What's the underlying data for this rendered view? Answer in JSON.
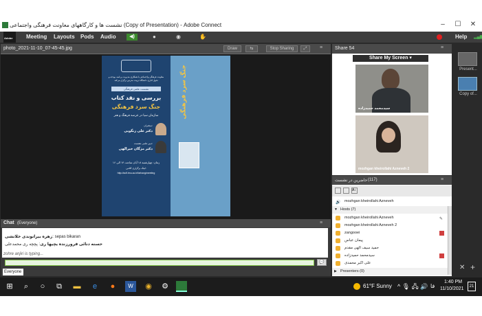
{
  "window": {
    "title": "نشست ها و کارگاههای معاونت فرهنگی واجتماعی (Copy of Presentation) - Adobe Connect",
    "minimize": "–",
    "maximize": "☐",
    "close": "✕"
  },
  "menubar": {
    "logo": "Adobe",
    "items": [
      "Meeting",
      "Layouts",
      "Pods",
      "Audio"
    ],
    "help": "Help"
  },
  "share_pod": {
    "title": "photo_2021-11-10_07-45-45.jpg",
    "draw_label": "Draw",
    "stop_label": "Stop Sharing"
  },
  "poster": {
    "header_lines": [
      "معاونت فرهنگی واجتماعی با همکاری مدیریت برنامه، بودجه و",
      "تحول اداری دانشگاه تربیت مدرس برگزار می‌کند"
    ],
    "banner": "نشست علمی فرهنگی",
    "title1": "بررسی و نقد کتاب",
    "title2": "جنگ سرد فرهنگی",
    "title3": "سازمان سیا در عرصه فرهنگ و هنر",
    "speaker_label": "سخنران:",
    "speaker_name": "دکتر علی زنگویی",
    "moderator_label": "دبیر علمی نشست:",
    "moderator_name": "دکتر مژگان خیرالهی",
    "when": "زمان: چهارشنبه ۱۸ آبان ساعت ۱۴ الی ۱۶",
    "link_label": "لینک برگزاری کلاس:",
    "url": "http://acfl.tmu.ac.ir/farhangimeeting",
    "book_cover_title": "جنگ سرد فرهنگی"
  },
  "chat": {
    "title": "Chat",
    "scope": "(Everyone)",
    "messages": [
      {
        "sender": "زهره بیرانوندی خلانشی",
        "text": "sepas bikaran"
      },
      {
        "sender": "حسنه دنائی فرورزنده یچیها ری",
        "text": "پچچه ری محمدعلی"
      }
    ],
    "typing": "zohre anjiri is typing...",
    "tab": "Everyone"
  },
  "camera_pod": {
    "title": "Share 54",
    "share_my_screen": "Share My Screen",
    "videos": [
      {
        "label": "سیدمحمد حمیدزاده"
      },
      {
        "label": "mozhgan kheirollahi Azneveh 2"
      }
    ]
  },
  "attendee_pod": {
    "title": "حاضرین در نشست",
    "count": "(117)",
    "speaker": "mozhgan kheirollahi Azneveh",
    "hosts_label": "Hosts (7)",
    "hosts": [
      "mozhgan kheirollahi Azneveh",
      "mozhgan kheirollahi Azneveh 2",
      "zangooei",
      "پیمان عباس",
      "حمید سیف الهی مقدم",
      "سیدمحمد حمیدزاده",
      "علی اکبر محمدی"
    ],
    "presenters_label": "Presenters (0)"
  },
  "layouts": [
    {
      "label": "Present..."
    },
    {
      "label": "Copy of..."
    }
  ],
  "taskbar": {
    "weather": "61°F  Sunny",
    "lang": "فا",
    "time": "1:40 PM",
    "date": "11/10/2021",
    "notifications": "21"
  }
}
